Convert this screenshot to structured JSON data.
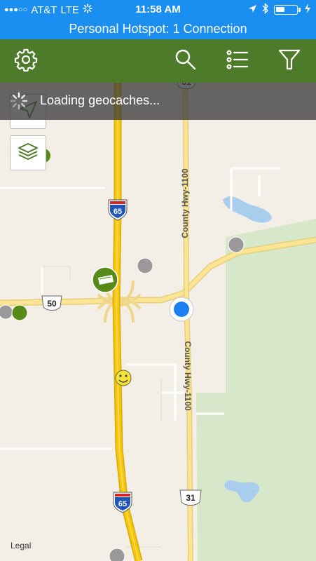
{
  "status_bar": {
    "carrier": "AT&T",
    "network": "LTE",
    "time": "11:58 AM",
    "signal_dots_filled": 3,
    "signal_dots_total": 5,
    "battery_level": 0.45,
    "icons": [
      "location-arrow-icon",
      "bluetooth-icon",
      "battery-icon",
      "charging-bolt-icon"
    ]
  },
  "hotspot_banner": {
    "text": "Personal Hotspot: 1 Connection"
  },
  "toolbar": {
    "background": "#4d7b2a",
    "icons": [
      "gear-icon",
      "search-icon",
      "list-icon",
      "filter-icon"
    ]
  },
  "loading": {
    "text": "Loading geocaches..."
  },
  "map": {
    "labels": {
      "road_north": "County Hwy-1100",
      "road_south": "County Hwy-1100",
      "shield_65_top": "65",
      "shield_65_bottom": "65",
      "shield_50": "50",
      "shield_31_bottom": "31",
      "shield_31_top": "31"
    },
    "colors": {
      "land": "#f4efe6",
      "forest": "#d6e8c9",
      "water": "#a9cdec",
      "interstate": "#f5c70e",
      "highway": "#fbe493",
      "minor_road": "#ffffff",
      "cache_green": "#588a1a",
      "cache_gray": "#999999",
      "user_location": "#1d80f2"
    },
    "legal": "Legal"
  }
}
